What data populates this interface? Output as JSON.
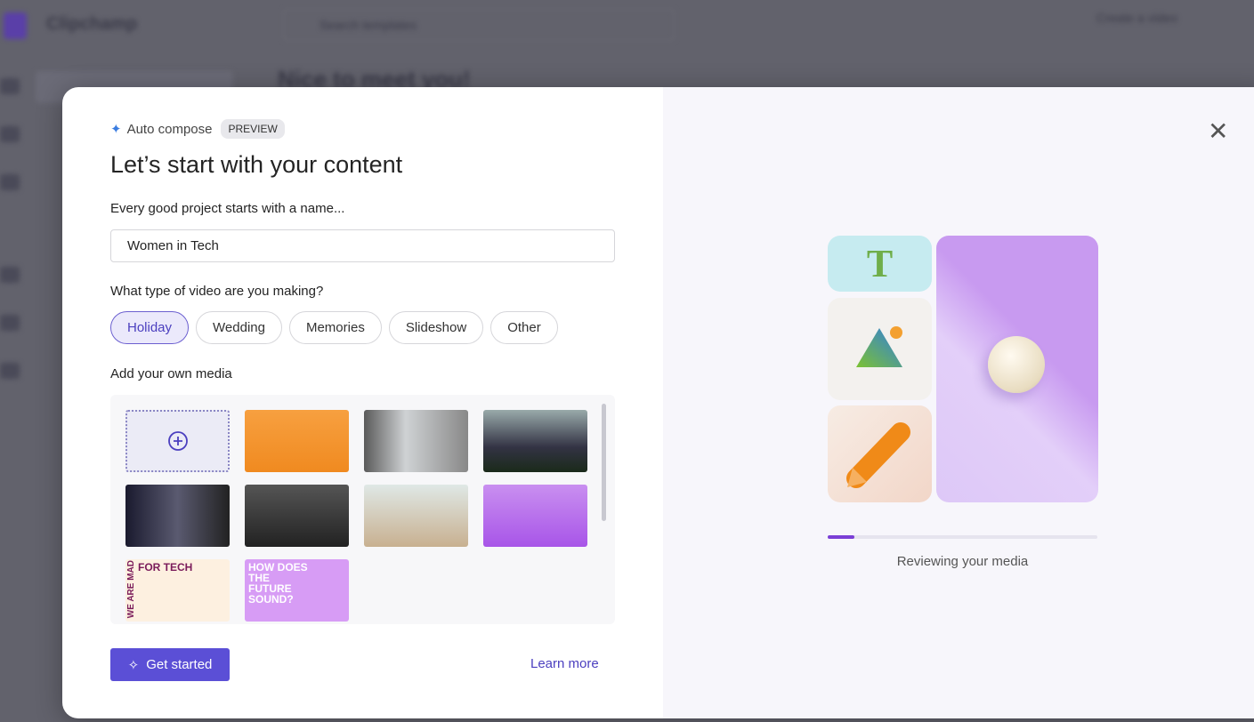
{
  "background": {
    "app_name": "Clipchamp",
    "search_placeholder": "Search templates",
    "create_label": "Create a video",
    "greeting": "Nice to meet you!"
  },
  "modal": {
    "feature": "Auto compose",
    "badge": "PREVIEW",
    "title": "Let’s start with your content",
    "name_label": "Every good project starts with a name...",
    "name_value": "Women in Tech",
    "type_label": "What type of video are you making?",
    "types": [
      {
        "label": "Holiday",
        "selected": true
      },
      {
        "label": "Wedding"
      },
      {
        "label": "Memories"
      },
      {
        "label": "Slideshow"
      },
      {
        "label": "Other"
      }
    ],
    "media_label": "Add your own media",
    "posters": {
      "p1": "FOR TECH",
      "p1v": "WE ARE MAD",
      "p2": "HOW DOES THE FUTURE SOUND?"
    },
    "get_started": "Get started",
    "learn_more": "Learn more",
    "status": "Reviewing your media",
    "progress_percent": 10,
    "accent": "#5b4fd6"
  }
}
